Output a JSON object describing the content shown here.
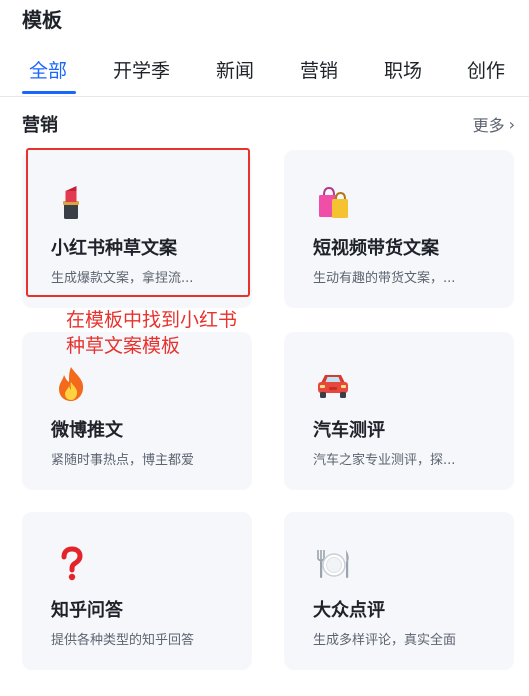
{
  "page_title": "模板",
  "tabs": [
    {
      "label": "全部",
      "active": true
    },
    {
      "label": "开学季",
      "active": false
    },
    {
      "label": "新闻",
      "active": false
    },
    {
      "label": "营销",
      "active": false
    },
    {
      "label": "职场",
      "active": false
    },
    {
      "label": "创作",
      "active": false
    }
  ],
  "section": {
    "title": "营销",
    "more_label": "更多",
    "more_icon": "chevron-right-icon"
  },
  "cards": [
    {
      "icon": "lipstick-icon",
      "title": "小红书种草文案",
      "desc": "生成爆款文案，拿捏流..."
    },
    {
      "icon": "shopping-bags-icon",
      "title": "短视频带货文案",
      "desc": "生动有趣的带货文案，..."
    },
    {
      "icon": "fire-icon",
      "title": "微博推文",
      "desc": "紧随时事热点，博主都爱"
    },
    {
      "icon": "car-icon",
      "title": "汽车测评",
      "desc": "汽车之家专业测评，探..."
    },
    {
      "icon": "question-mark-icon",
      "title": "知乎问答",
      "desc": "提供各种类型的知乎回答"
    },
    {
      "icon": "plate-cutlery-icon",
      "title": "大众点评",
      "desc": "生成多样评论，真实全面"
    }
  ],
  "annotation": {
    "text": "在模板中找到小红书种草文案模板",
    "color": "#e8322e"
  },
  "colors": {
    "accent": "#1a66ff",
    "card_bg": "#f6f7fb",
    "annotation": "#e8322e"
  }
}
